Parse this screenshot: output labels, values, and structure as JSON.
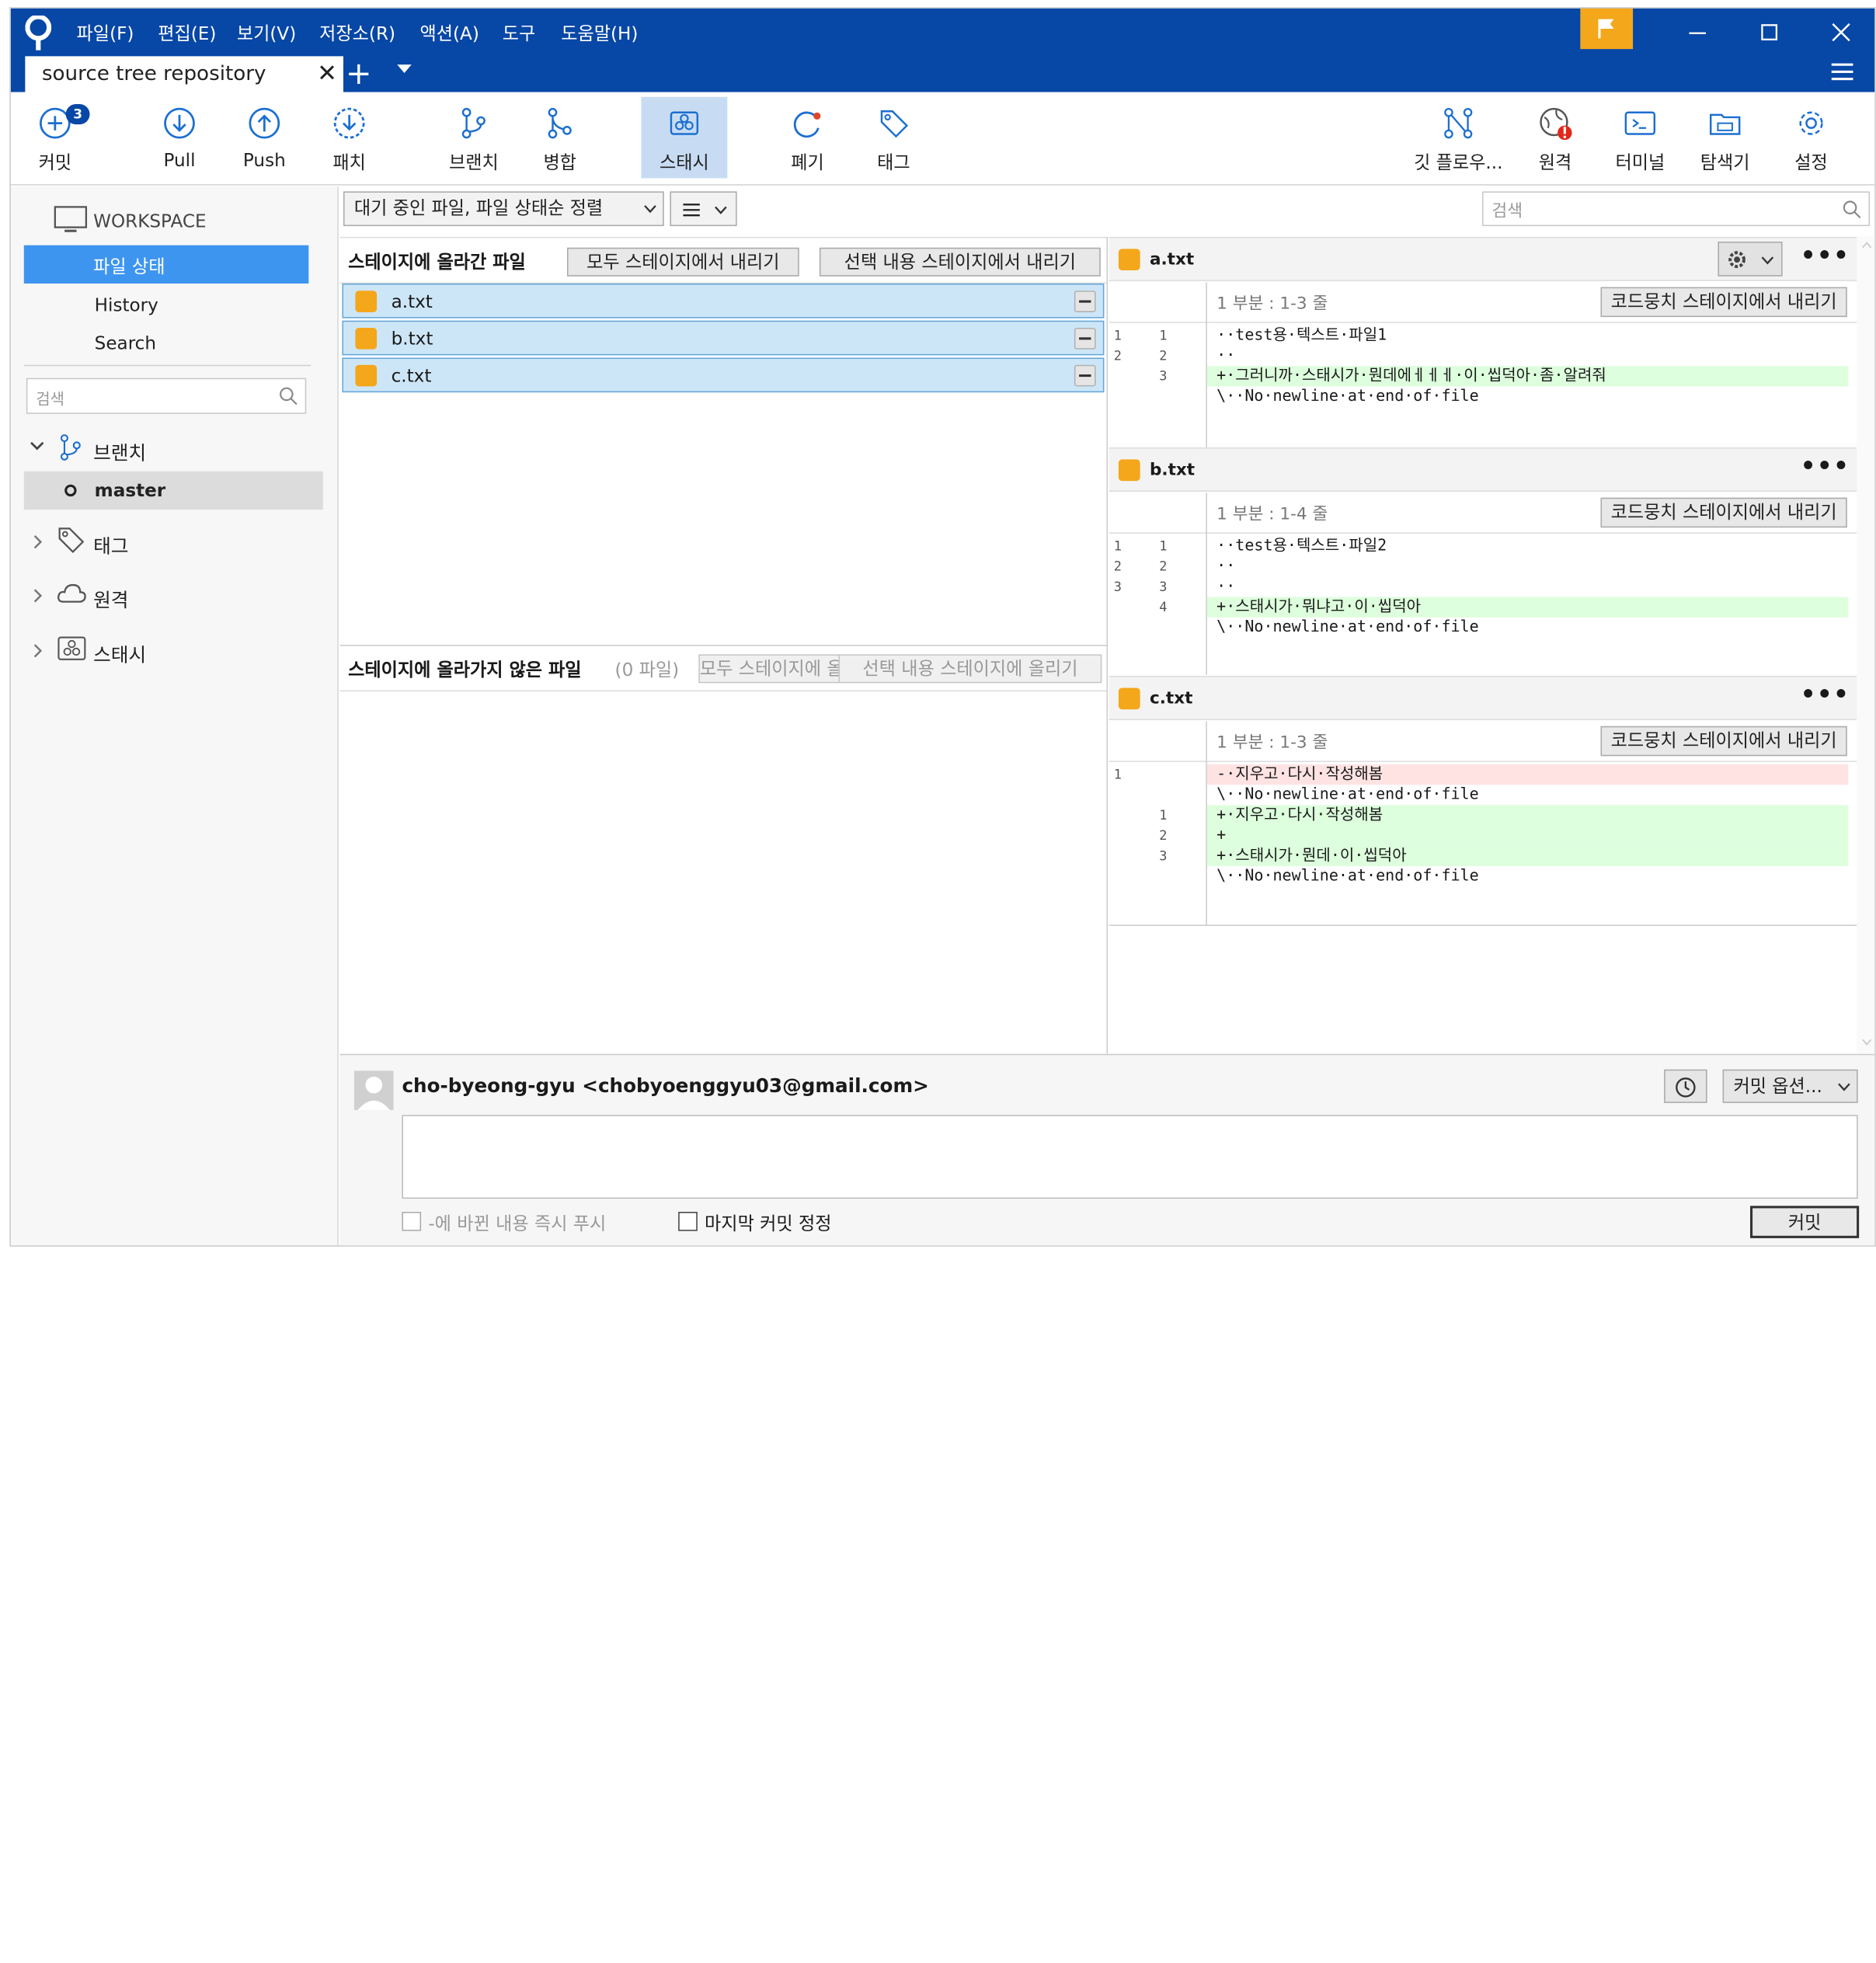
{
  "titlebar": {
    "menus": [
      "파일(F)",
      "편집(E)",
      "보기(V)",
      "저장소(R)",
      "액션(A)",
      "도구",
      "도움말(H)"
    ],
    "tab_title": "source tree repository",
    "colors": {
      "bar": "#0747a6",
      "flag": "#f4a71a"
    }
  },
  "toolbar": {
    "commit": {
      "label": "커밋",
      "badge": "3"
    },
    "pull": "Pull",
    "push": "Push",
    "patch": "패치",
    "branch": "브랜치",
    "merge": "병합",
    "stash": "스태시",
    "discard": "폐기",
    "tag": "태그",
    "gitflow": "깃 플로우...",
    "remote": "원격",
    "terminal": "터미널",
    "explorer": "탐색기",
    "settings": "설정"
  },
  "sidebar": {
    "workspace": "WORKSPACE",
    "items": [
      "파일 상태",
      "History",
      "Search"
    ],
    "search_placeholder": "검색",
    "branches": "브랜치",
    "master": "master",
    "tags": "태그",
    "remotes": "원격",
    "stashes": "스태시"
  },
  "filter": {
    "sort_label": "대기 중인 파일, 파일 상태순 정렬",
    "search_placeholder": "검색"
  },
  "staged": {
    "header": "스테이지에 올라간 파일",
    "unstage_all": "모두 스테이지에서 내리기",
    "unstage_selected": "선택 내용 스테이지에서 내리기",
    "files": [
      "a.txt",
      "b.txt",
      "c.txt"
    ]
  },
  "unstaged": {
    "header": "스테이지에 올라가지 않은 파일",
    "count": "(0 파일)",
    "stage_all": "모두 스테이지에 올리기",
    "stage_selected": "선택 내용 스테이지에 올리기"
  },
  "diffs": [
    {
      "file": "a.txt",
      "hunk": "1 부분 : 1-3 줄",
      "hunk_button": "코드뭉치 스테이지에서 내리기",
      "lines": [
        {
          "old": "1",
          "new": "1",
          "type": "ctx",
          "text": "··test용·텍스트·파일1"
        },
        {
          "old": "2",
          "new": "2",
          "type": "ctx",
          "text": "··"
        },
        {
          "old": "",
          "new": "3",
          "type": "add",
          "text": "+·그러니까·스태시가·뭔데에ㅔㅔㅔ·이·씹덕아·좀·알려줘"
        },
        {
          "old": "",
          "new": "",
          "type": "ctx",
          "text": "\\··No·newline·at·end·of·file"
        }
      ]
    },
    {
      "file": "b.txt",
      "hunk": "1 부분 : 1-4 줄",
      "hunk_button": "코드뭉치 스테이지에서 내리기",
      "lines": [
        {
          "old": "1",
          "new": "1",
          "type": "ctx",
          "text": "··test용·텍스트·파일2"
        },
        {
          "old": "2",
          "new": "2",
          "type": "ctx",
          "text": "··"
        },
        {
          "old": "3",
          "new": "3",
          "type": "ctx",
          "text": "··"
        },
        {
          "old": "",
          "new": "4",
          "type": "add",
          "text": "+·스태시가·뭐냐고·이·씹덕아"
        },
        {
          "old": "",
          "new": "",
          "type": "ctx",
          "text": "\\··No·newline·at·end·of·file"
        }
      ]
    },
    {
      "file": "c.txt",
      "hunk": "1 부분 : 1-3 줄",
      "hunk_button": "코드뭉치 스테이지에서 내리기",
      "lines": [
        {
          "old": "1",
          "new": "",
          "type": "del",
          "text": "-·지우고·다시·작성해봄"
        },
        {
          "old": "",
          "new": "",
          "type": "ctx",
          "text": "\\··No·newline·at·end·of·file"
        },
        {
          "old": "",
          "new": "1",
          "type": "add",
          "text": "+·지우고·다시·작성해봄"
        },
        {
          "old": "",
          "new": "2",
          "type": "add",
          "text": "+"
        },
        {
          "old": "",
          "new": "3",
          "type": "add",
          "text": "+·스태시가·뭔데·이·씹덕아"
        },
        {
          "old": "",
          "new": "",
          "type": "ctx",
          "text": "\\··No·newline·at·end·of·file"
        }
      ]
    }
  ],
  "commit_area": {
    "author": "cho-byeong-gyu <chobyoenggyu03@gmail.com>",
    "options": "커밋 옵션...",
    "push_checkbox": "-에 바뀐 내용 즉시 푸시",
    "amend_checkbox": "마지막 커밋 정정",
    "commit_button": "커밋"
  }
}
